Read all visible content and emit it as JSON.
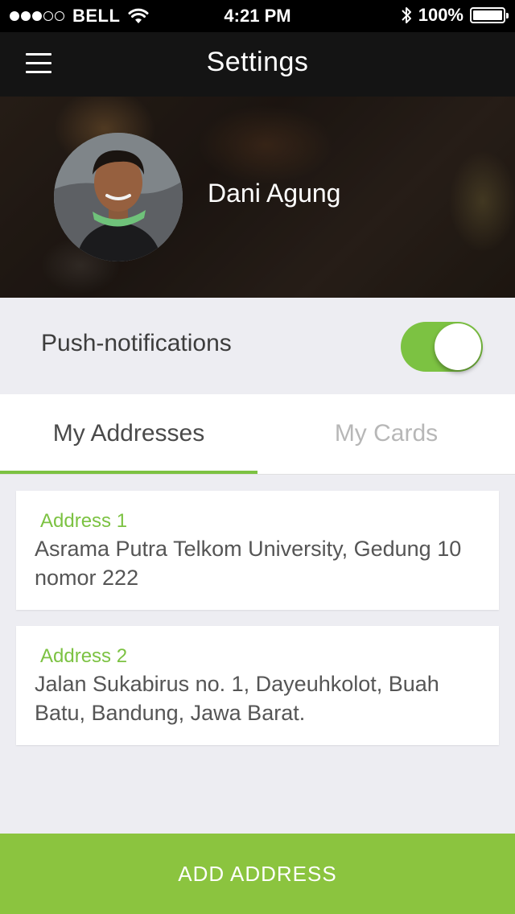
{
  "status_bar": {
    "carrier": "BELL",
    "time": "4:21 PM",
    "battery": "100%",
    "signal_filled": 3,
    "signal_total": 5,
    "icons": [
      "signal-dots-icon",
      "wifi-icon",
      "bluetooth-icon",
      "battery-icon"
    ]
  },
  "nav": {
    "title": "Settings",
    "menu_icon": "hamburger-menu-icon"
  },
  "profile": {
    "name": "Dani Agung",
    "avatar": "profile-photo"
  },
  "push": {
    "label": "Push-notifications",
    "enabled": true
  },
  "tabs": [
    {
      "label": "My Addresses",
      "active": true
    },
    {
      "label": "My Cards",
      "active": false
    }
  ],
  "addresses": [
    {
      "title": "Address 1",
      "text": "Asrama Putra Telkom University, Gedung 10 nomor 222"
    },
    {
      "title": "Address 2",
      "text": "Jalan Sukabirus no. 1, Dayeuhkolot, Buah Batu, Bandung, Jawa Barat."
    }
  ],
  "add_button": {
    "label": "ADD ADDRESS"
  },
  "colors": {
    "accent": "#7cc242",
    "button": "#8bc43f",
    "nav_background": "#141414",
    "page_background": "#ededf2"
  }
}
